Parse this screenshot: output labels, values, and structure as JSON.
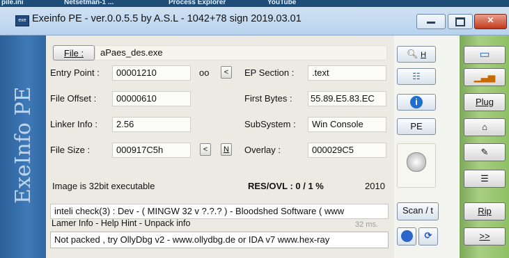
{
  "background_tabs": [
    "pile.ini",
    "Netsetman-1 ...",
    "Process Explorer",
    "YouTube"
  ],
  "window": {
    "title": "Exeinfo PE - ver.0.0.5.5  by A.S.L - 1042+78 sign  2019.03.01",
    "app_icon": "exe-icon"
  },
  "sidebar": {
    "brand": "ExeInfo PE"
  },
  "file": {
    "button_label": "File :",
    "name": "aPaes_des.exe"
  },
  "fields": {
    "entry_point": {
      "label": "Entry Point :",
      "value": "00001210",
      "oo": "oo",
      "arrow": "<"
    },
    "ep_section": {
      "label": "EP Section :",
      "value": ".text"
    },
    "file_offset": {
      "label": "File Offset :",
      "value": "00000610"
    },
    "first_bytes": {
      "label": "First Bytes :",
      "value": "55.89.E5.83.EC"
    },
    "linker_info": {
      "label": "Linker Info :",
      "value": "2.56"
    },
    "subsystem": {
      "label": "SubSystem :",
      "value": "Win Console"
    },
    "file_size": {
      "label": "File Size :",
      "value": "000917C5h",
      "arrow": "<",
      "n": "N"
    },
    "overlay": {
      "label": "Overlay :",
      "value": "000029C5"
    }
  },
  "image_info": {
    "text": "Image is 32bit executable",
    "res_ovl": "RES/OVL : 0 / 1 %",
    "year": "2010"
  },
  "scan": {
    "detect": "inteli check(3) : Dev - ( MINGW 32 v ?.?.? ) - Bloodshed Software ( www",
    "lamer_info": "Lamer Info - Help Hint - Unpack info",
    "time": "32 ms.",
    "hint": "Not packed , try OllyDbg v2 - www.ollydbg.de or IDA v7 www.hex-ray"
  },
  "right_buttons": {
    "h": "H",
    "pe": "PE",
    "scan": "Scan / t"
  },
  "far_buttons": {
    "plug": "Plug",
    "rip": "Rip",
    "next": ">>"
  }
}
